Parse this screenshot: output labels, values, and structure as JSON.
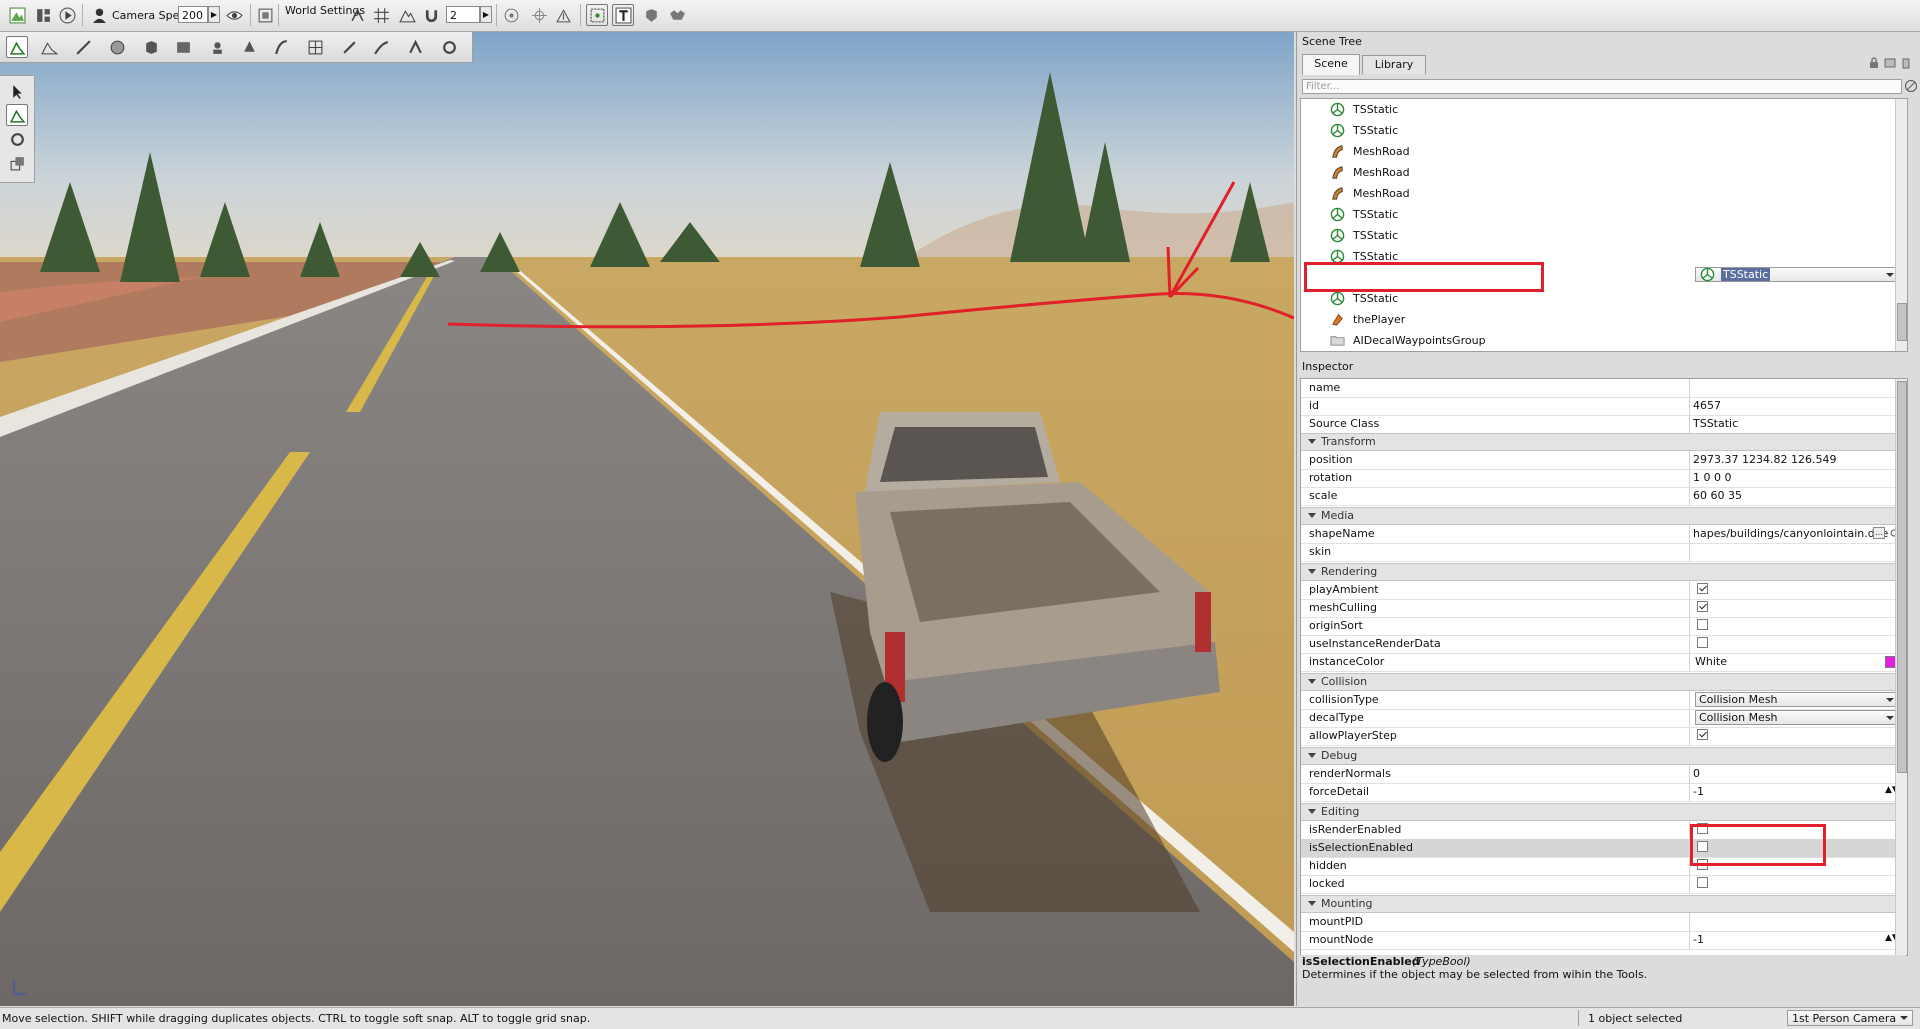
{
  "toolbar": {
    "camera_speed_label": "Camera Speed",
    "camera_speed_value": "200",
    "world_settings_label": "World Settings",
    "grid_value": "2"
  },
  "scene_tree": {
    "title": "Scene Tree",
    "tabs": [
      {
        "label": "Scene"
      },
      {
        "label": "Library"
      }
    ],
    "filter_placeholder": "Filter...",
    "items": [
      {
        "label": "TSStatic",
        "icon": "tsstatic-icon"
      },
      {
        "label": "TSStatic",
        "icon": "tsstatic-icon"
      },
      {
        "label": "MeshRoad",
        "icon": "meshroad-icon"
      },
      {
        "label": "MeshRoad",
        "icon": "meshroad-icon"
      },
      {
        "label": "MeshRoad",
        "icon": "meshroad-icon"
      },
      {
        "label": "TSStatic",
        "icon": "tsstatic-icon"
      },
      {
        "label": "TSStatic",
        "icon": "tsstatic-icon"
      },
      {
        "label": "TSStatic",
        "icon": "tsstatic-icon"
      },
      {
        "label": "TSStatic",
        "icon": "tsstatic-icon",
        "selected": true
      },
      {
        "label": "TSStatic",
        "icon": "tsstatic-icon"
      },
      {
        "label": "thePlayer",
        "icon": "player-icon"
      },
      {
        "label": "AIDecalWaypointsGroup",
        "icon": "folder-icon"
      }
    ]
  },
  "inspector": {
    "title": "Inspector",
    "general": {
      "name_key": "name",
      "name_val": "",
      "id_key": "id",
      "id_val": "4657",
      "class_key": "Source Class",
      "class_val": "TSStatic"
    },
    "groups": {
      "transform": "Transform",
      "media": "Media",
      "rendering": "Rendering",
      "collision": "Collision",
      "debug": "Debug",
      "editing": "Editing",
      "mounting": "Mounting"
    },
    "transform": {
      "position_key": "position",
      "position_val": "2973.37 1234.82 126.549",
      "rotation_key": "rotation",
      "rotation_val": "1 0 0 0",
      "scale_key": "scale",
      "scale_val": "60 60 35"
    },
    "media": {
      "shape_key": "shapeName",
      "shape_val": "hapes/buildings/canyonlointain.dae",
      "skin_key": "skin",
      "skin_val": ""
    },
    "rendering": {
      "play_ambient": "playAmbient",
      "mesh_culling": "meshCulling",
      "origin_sort": "originSort",
      "use_instance": "useInstanceRenderData",
      "instance_color": "instanceColor",
      "instance_color_val": "White",
      "swatch_color": "#e020e0"
    },
    "collision": {
      "collision_type_key": "collisionType",
      "collision_type_val": "Collision Mesh",
      "decal_type_key": "decalType",
      "decal_type_val": "Collision Mesh",
      "allow_player_key": "allowPlayerStep"
    },
    "debug": {
      "render_normals_key": "renderNormals",
      "render_normals_val": "0",
      "force_detail_key": "forceDetail",
      "force_detail_val": "-1"
    },
    "editing": {
      "render_enabled": "isRenderEnabled",
      "selection_enabled": "isSelectionEnabled",
      "hidden": "hidden",
      "locked": "locked"
    },
    "mounting": {
      "mount_pid_key": "mountPID",
      "mount_pid_val": "",
      "mount_node_key": "mountNode",
      "mount_node_val": "-1"
    },
    "description_title": "isSelectionEnabled",
    "description_type": "(TypeBool)",
    "description_text": "Determines if the object may be selected from wihin the Tools."
  },
  "status": {
    "hint": "Move selection.  SHIFT while dragging duplicates objects.  CTRL to toggle soft snap.  ALT to toggle grid snap.",
    "selection": "1 object selected",
    "camera": "1st Person Camera"
  },
  "colors": {
    "annotation_red": "#e0202a",
    "selection_blue": "#5b6f9e"
  }
}
